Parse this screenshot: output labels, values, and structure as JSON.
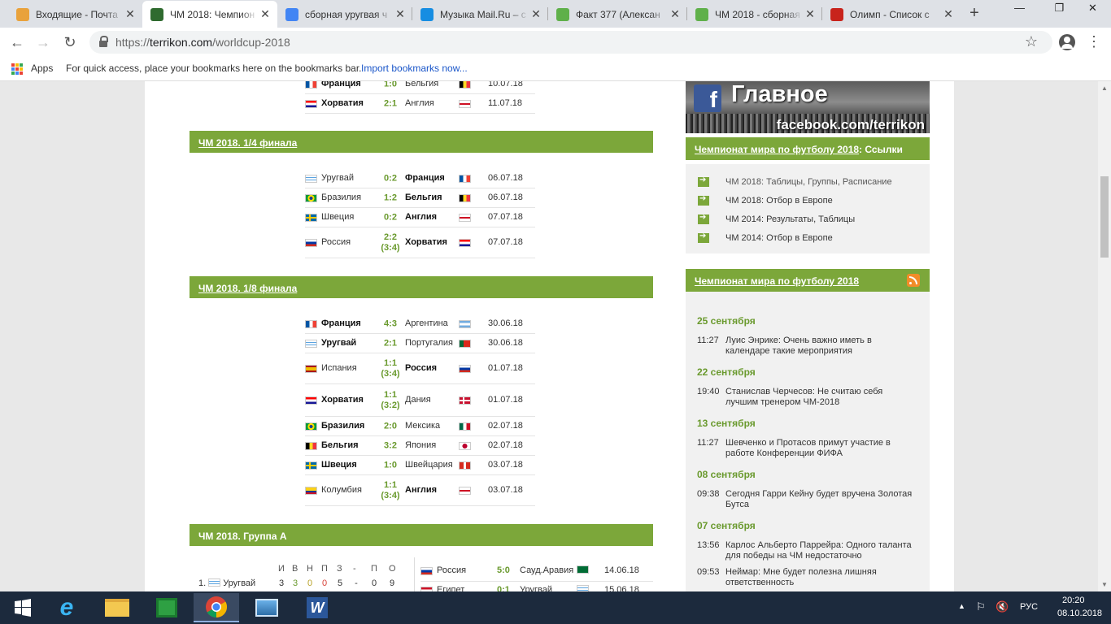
{
  "tabs": [
    {
      "title": "Входящие - Почта",
      "favicon_color": "#e9a23b",
      "favicon": "envelope-icon"
    },
    {
      "title": "ЧМ 2018: Чемпион",
      "favicon_color": "#2f6b2f",
      "favicon": "terrikon-icon",
      "active": true
    },
    {
      "title": "сборная уругвая ч",
      "favicon_color": "#4285f4",
      "favicon": "google-icon"
    },
    {
      "title": "Музыка Mail.Ru – с",
      "favicon_color": "#168de2",
      "favicon": "mailru-music-icon"
    },
    {
      "title": "Факт 377 (Алексан",
      "favicon_color": "#5fb04a",
      "favicon": "green-square-icon"
    },
    {
      "title": "ЧМ 2018 - сборная",
      "favicon_color": "#5fb04a",
      "favicon": "green-square-icon"
    },
    {
      "title": "Олимп - Список с",
      "favicon_color": "#c8231b",
      "favicon": "olimp-icon"
    }
  ],
  "address": {
    "scheme": "https://",
    "host": "terrikon.com",
    "path": "/worldcup-2018"
  },
  "bookmarks": {
    "apps_label": "Apps",
    "hint": "For quick access, place your bookmarks here on the bookmarks bar.",
    "import_link": "Import bookmarks now..."
  },
  "semifinal_partial": [
    {
      "home": "Франция",
      "home_win": true,
      "home_flag": [
        "#0055a4",
        "#ffffff",
        "#ef4135"
      ],
      "score": "1:0",
      "away": "Бельгия",
      "away_flag": [
        "#000000",
        "#fdda24",
        "#ef3340"
      ],
      "date": "10.07.18"
    },
    {
      "home": "Хорватия",
      "home_win": true,
      "home_flag": [
        "#ff0000",
        "#ffffff",
        "#171796"
      ],
      "score": "2:1",
      "away": "Англия",
      "away_flag": "england",
      "date": "11.07.18"
    }
  ],
  "quarterfinal": {
    "title": "ЧМ 2018. 1/4 финала",
    "matches": [
      {
        "home": "Уругвай",
        "home_flag": "uruguay",
        "score": "0:2",
        "away": "Франция",
        "away_win": true,
        "away_flag": [
          "#0055a4",
          "#ffffff",
          "#ef4135"
        ],
        "date": "06.07.18"
      },
      {
        "home": "Бразилия",
        "home_flag": "brazil",
        "score": "1:2",
        "away": "Бельгия",
        "away_win": true,
        "away_flag": [
          "#000000",
          "#fdda24",
          "#ef3340"
        ],
        "date": "06.07.18"
      },
      {
        "home": "Швеция",
        "home_flag": "sweden",
        "score": "0:2",
        "away": "Англия",
        "away_win": true,
        "away_flag": "england",
        "date": "07.07.18"
      },
      {
        "home": "Россия",
        "home_flag": [
          "#ffffff",
          "#0039a6",
          "#d52b1e"
        ],
        "score": "2:2",
        "pens": "(3:4)",
        "away": "Хорватия",
        "away_win": true,
        "away_flag": [
          "#ff0000",
          "#ffffff",
          "#171796"
        ],
        "date": "07.07.18"
      }
    ]
  },
  "round16": {
    "title": "ЧМ 2018. 1/8 финала",
    "matches": [
      {
        "home": "Франция",
        "home_win": true,
        "home_flag": [
          "#0055a4",
          "#ffffff",
          "#ef4135"
        ],
        "score": "4:3",
        "away": "Аргентина",
        "away_flag": "argentina",
        "date": "30.06.18"
      },
      {
        "home": "Уругвай",
        "home_win": true,
        "home_flag": "uruguay",
        "score": "2:1",
        "away": "Португалия",
        "away_flag": "portugal",
        "date": "30.06.18"
      },
      {
        "home": "Испания",
        "home_flag": "spain",
        "score": "1:1",
        "pens": "(3:4)",
        "away": "Россия",
        "away_win": true,
        "away_flag": [
          "#ffffff",
          "#0039a6",
          "#d52b1e"
        ],
        "date": "01.07.18"
      },
      {
        "home": "Хорватия",
        "home_win": true,
        "home_flag": [
          "#ff0000",
          "#ffffff",
          "#171796"
        ],
        "score": "1:1",
        "pens": "(3:2)",
        "away": "Дания",
        "away_flag": "denmark",
        "date": "01.07.18"
      },
      {
        "home": "Бразилия",
        "home_win": true,
        "home_flag": "brazil",
        "score": "2:0",
        "away": "Мексика",
        "away_flag": "mexico",
        "date": "02.07.18"
      },
      {
        "home": "Бельгия",
        "home_win": true,
        "home_flag": [
          "#000000",
          "#fdda24",
          "#ef3340"
        ],
        "score": "3:2",
        "away": "Япония",
        "away_flag": "japan",
        "date": "02.07.18"
      },
      {
        "home": "Швеция",
        "home_win": true,
        "home_flag": "sweden",
        "score": "1:0",
        "away": "Швейцария",
        "away_flag": "switzerland",
        "date": "03.07.18"
      },
      {
        "home": "Колумбия",
        "home_flag": "colombia",
        "score": "1:1",
        "pens": "(3:4)",
        "away": "Англия",
        "away_win": true,
        "away_flag": "england",
        "date": "03.07.18"
      }
    ]
  },
  "group_a": {
    "title": "ЧМ 2018. Группа А",
    "headers": [
      "И",
      "В",
      "Н",
      "П",
      "З",
      "-",
      "П",
      "О"
    ],
    "rows": [
      {
        "pos": "1.",
        "team": "Уругвай",
        "flag": "uruguay",
        "values": [
          "3",
          "3",
          "0",
          "0",
          "5",
          "-",
          "0",
          "9"
        ]
      }
    ],
    "matches": [
      {
        "home": "Россия",
        "home_flag": [
          "#ffffff",
          "#0039a6",
          "#d52b1e"
        ],
        "score": "5:0",
        "away": "Сауд.Аравия",
        "away_flag": "saudi",
        "date": "14.06.18"
      },
      {
        "home": "Египет",
        "home_flag": [
          "#ce1126",
          "#ffffff",
          "#000000"
        ],
        "score": "0:1",
        "away": "Уругвай",
        "away_flag": "uruguay",
        "date": "15.06.18"
      }
    ]
  },
  "sidebar": {
    "fb_title": "Главное",
    "fb_url": "facebook.com/terrikon",
    "links_header_link": "Чемпионат мира по футболу 2018",
    "links_header_rest": ": Ссылки",
    "links": [
      {
        "label": "ЧМ 2018: Таблицы, Группы, Расписание",
        "visited": true
      },
      {
        "label": "ЧМ 2018: Отбор в Европе"
      },
      {
        "label": "ЧМ 2014: Результаты, Таблицы"
      },
      {
        "label": "ЧМ 2014: Отбор в Европе"
      }
    ],
    "news_header": "Чемпионат мира по футболу 2018",
    "news": [
      {
        "date": "25 сентября",
        "items": [
          {
            "time": "11:27",
            "text": "Луис Энрике: Очень важно иметь в календаре такие мероприятия"
          }
        ]
      },
      {
        "date": "22 сентября",
        "items": [
          {
            "time": "19:40",
            "text": "Станислав Черчесов: Не считаю себя лучшим тренером ЧМ-2018"
          }
        ]
      },
      {
        "date": "13 сентября",
        "items": [
          {
            "time": "11:27",
            "text": "Шевченко и Протасов примут участие в работе Конференции ФИФА"
          }
        ]
      },
      {
        "date": "08 сентября",
        "items": [
          {
            "time": "09:38",
            "text": "Сегодня Гарри Кейну будет вручена Золотая Бутса"
          }
        ]
      },
      {
        "date": "07 сентября",
        "items": [
          {
            "time": "13:56",
            "text": "Карлос Альберто Паррейра: Одного таланта для победы на ЧМ недостаточно"
          },
          {
            "time": "09:53",
            "text": "Неймар: Мне будет полезна лишняя ответственность"
          }
        ]
      }
    ]
  },
  "taskbar": {
    "lang": "РУС",
    "time": "20:20",
    "date": "08.10.2018"
  },
  "colors": {
    "accent_green": "#7ca73a",
    "score_green": "#6a9a2e"
  }
}
